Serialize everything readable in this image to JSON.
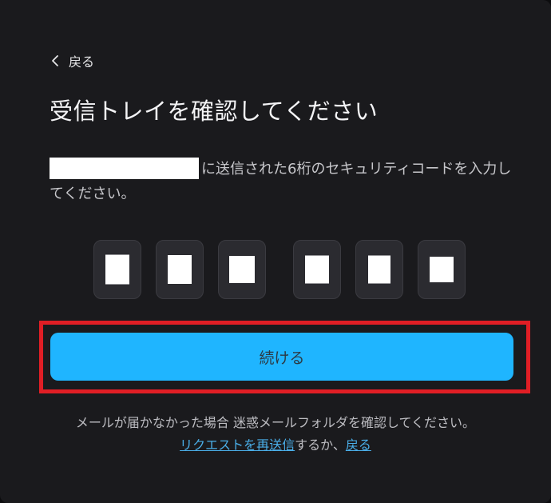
{
  "back": {
    "label": "戻る"
  },
  "title": "受信トレイを確認してください",
  "description": {
    "text": "に送信された6桁のセキュリティコードを入力してください。"
  },
  "code": {
    "digit_count": 6
  },
  "continue_button": {
    "label": "続ける"
  },
  "footer": {
    "line1": "メールが届かなかった場合 迷惑メールフォルダを確認してください。",
    "resend_link": "リクエストを再送信",
    "middle_text": "するか、",
    "back_link": "戻る"
  },
  "colors": {
    "panel_bg": "#1a1a1d",
    "digit_bg": "#2b2b30",
    "primary_button": "#1fb5ff",
    "link": "#4aaee8",
    "highlight_border": "#e01e25"
  }
}
